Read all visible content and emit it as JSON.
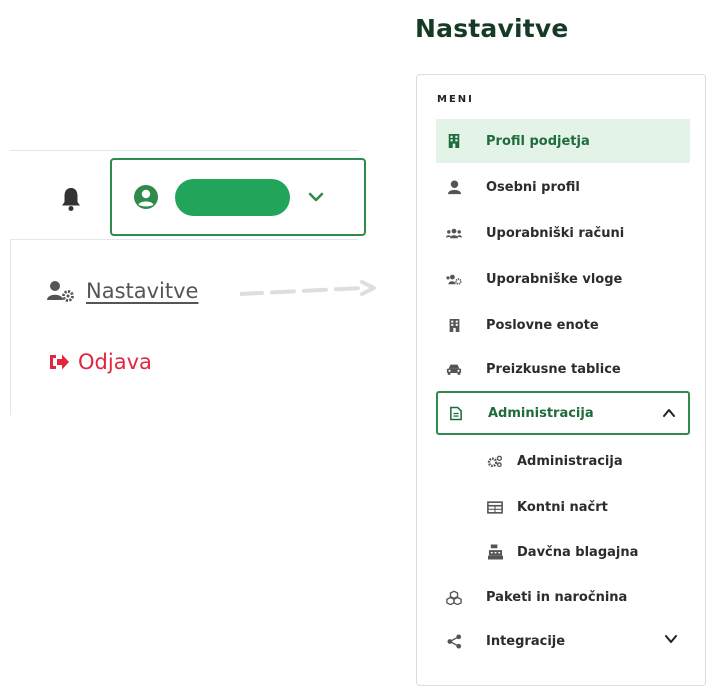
{
  "header": {
    "bell_icon": "bell-icon",
    "user_icon": "user-circle-icon",
    "user_name_redacted": true,
    "dropdown_icon": "chevron-down-icon"
  },
  "user_menu": {
    "settings_label": "Nastavitve",
    "logout_label": "Odjava"
  },
  "settings": {
    "title": "Nastavitve",
    "menu_heading": "MENI",
    "items": [
      {
        "label": "Profil podjetja",
        "icon": "building-icon",
        "active": true
      },
      {
        "label": "Osebni profil",
        "icon": "user-icon"
      },
      {
        "label": "Uporabniški računi",
        "icon": "users-icon"
      },
      {
        "label": "Uporabniške vloge",
        "icon": "users-cog-icon"
      },
      {
        "label": "Poslovne enote",
        "icon": "building-icon"
      },
      {
        "label": "Preizkusne tablice",
        "icon": "car-icon"
      },
      {
        "label": "Administracija",
        "icon": "document-icon",
        "expanded": true
      },
      {
        "label": "Paketi in naročnina",
        "icon": "cubes-icon"
      },
      {
        "label": "Integracije",
        "icon": "share-icon",
        "expanded": false
      }
    ],
    "sub_items": [
      {
        "label": "Administracija",
        "icon": "cogs-icon"
      },
      {
        "label": "Kontni načrt",
        "icon": "table-icon"
      },
      {
        "label": "Davčna blagajna",
        "icon": "cash-register-icon"
      }
    ]
  },
  "colors": {
    "brand_green": "#2f8a4c",
    "active_bg": "#e4f3e8",
    "logout_red": "#e0273f",
    "title_dark": "#153a26"
  }
}
